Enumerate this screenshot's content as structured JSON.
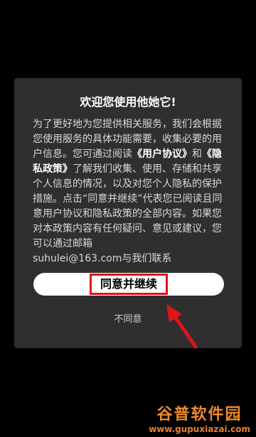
{
  "dialog": {
    "title": "欢迎您使用他她它!",
    "body": {
      "p1": "为了更好地为您提供相关服务，我们会根据您使用服务的具体功能需要，收集必要的用户信息。您可通过阅读",
      "user_agreement": "《用户协议》",
      "and": "和",
      "privacy_policy": "《隐私政策》",
      "p2": "了解我们收集、使用、存储和共享个人信息的情况，以及对您个人隐私的保护措施。点击“同意并继续”代表您已阅读且同意用户协议和隐私政策的全部内容。如果您对本政策内容有任何疑问、意见或建议，您可以通过邮箱",
      "email": "suhulei@163.com",
      "p3": "与我们联系"
    },
    "accept_label": "同意并继续",
    "decline_label": "不同意"
  },
  "watermark": {
    "logo_text": "谷普软件园",
    "url": "www.gupuxiazai.com"
  },
  "colors": {
    "background": "#000000",
    "dialog": "#2f2f2f",
    "highlight": "#e0131b"
  }
}
